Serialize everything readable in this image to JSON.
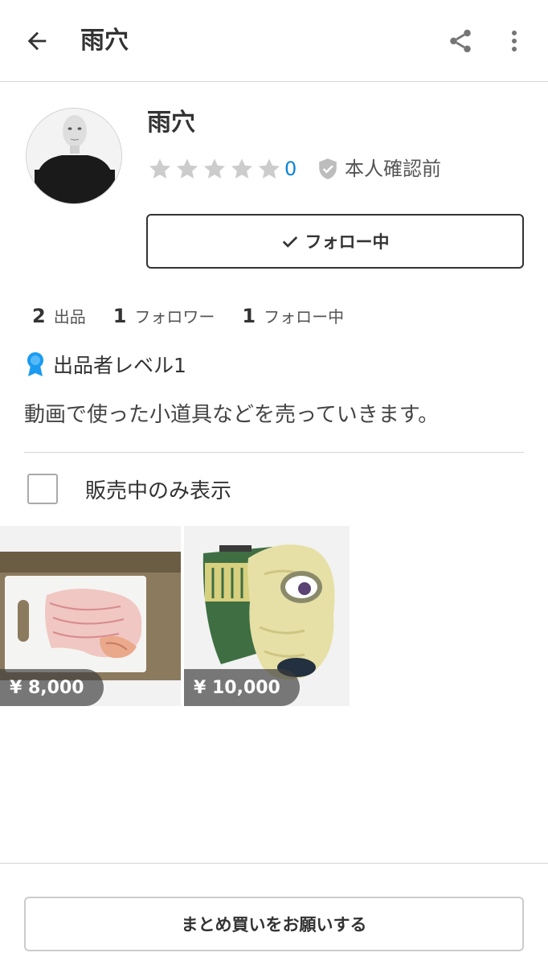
{
  "header": {
    "title": "雨穴",
    "back_icon": "arrow-left-icon",
    "share_icon": "share-icon",
    "more_icon": "more-vertical-icon"
  },
  "profile": {
    "name": "雨穴",
    "rating_count": "0",
    "stars_filled": 0,
    "stars_total": 5,
    "verification": "本人確認前",
    "follow_button": "フォロー中"
  },
  "stats": {
    "listings_count": "2",
    "listings_label": "出品",
    "followers_count": "1",
    "followers_label": "フォロワー",
    "following_count": "1",
    "following_label": "フォロー中"
  },
  "level": {
    "label": "出品者レベル1",
    "badge_color": "#1a9bf0"
  },
  "bio": "動画で使った小道具などを売っていきます。",
  "filter": {
    "label": "販売中のみ表示",
    "checked": false
  },
  "items": [
    {
      "price": "¥ 8,000"
    },
    {
      "price": "¥ 10,000"
    }
  ],
  "bottom": {
    "bulk_button": "まとめ買いをお願いする"
  },
  "colors": {
    "accent_blue": "#0b84d8",
    "star_gray": "#cccccc",
    "text": "#333333"
  }
}
